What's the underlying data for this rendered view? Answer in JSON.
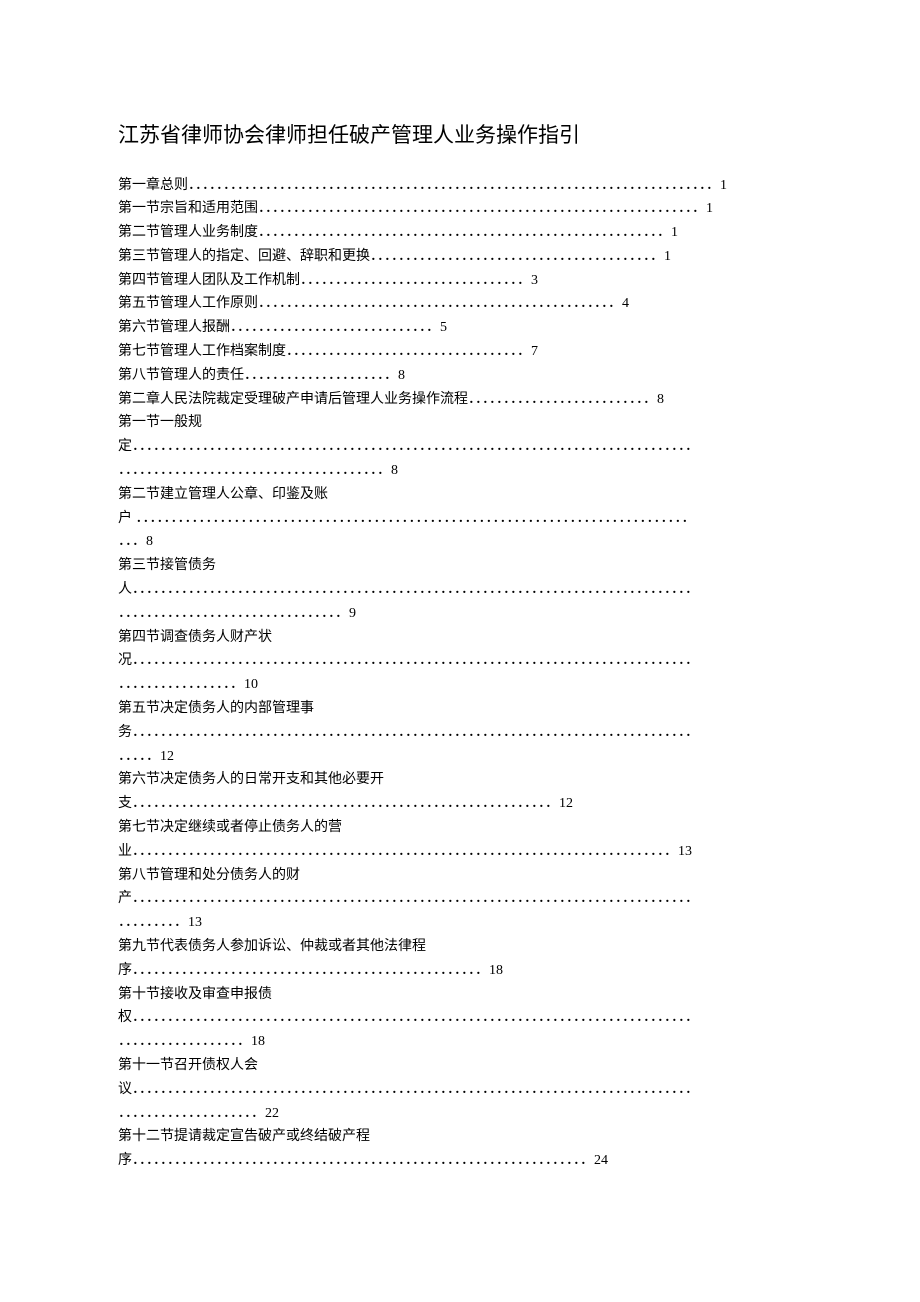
{
  "title": "江苏省律师协会律师担任破产管理人业务操作指引",
  "toc_lines": [
    "第一章总则．．．．．．．．．．．．．．．．．．．．．．．．．．．．．．．．．．．．．．．．．．．．．．．．．．．．．．．．．．．．．．．．．．．．．．．．．．．1",
    "第一节宗旨和适用范围．．．．．．．．．．．．．．．．．．．．．．．．．．．．．．．．．．．．．．．．．．．．．．．．．．．．．．．．．．．．．．．1",
    "第二节管理人业务制度．．．．．．．．．．．．．．．．．．．．．．．．．．．．．．．．．．．．．．．．．．．．．．．．．．．．．．．．．．1",
    "第三节管理人的指定、回避、辞职和更换．．．．．．．．．．．．．．．．．．．．．．．．．．．．．．．．．．．．．．．．．1",
    "第四节管理人团队及工作机制．．．．．．．．．．．．．．．．．．．．．．．．．．．．．．．．3",
    "第五节管理人工作原则．．．．．．．．．．．．．．．．．．．．．．．．．．．．．．．．．．．．．．．．．．．．．．．．．．．4",
    "第六节管理人报酬．．．．．．．．．．．．．．．．．．．．．．．．．．．．．5",
    "第七节管理人工作档案制度．．．．．．．．．．．．．．．．．．．．．．．．．．．．．．．．．．7",
    "第八节管理人的责任．．．．．．．．．．．．．．．．．．．．．8",
    "第二章人民法院裁定受理破产申请后管理人业务操作流程．．．．．．．．．．．．．．．．．．．．．．．．．．8",
    "第一节一般规",
    "定．．．．．．．．．．．．．．．．．．．．．．．．．．．．．．．．．．．．．．．．．．．．．．．．．．．．．．．．．．．．．．．．．．．．．．．．．．．．．．．．",
    "．．．．．．．．．．．．．．．．．．．．．．．．．．．．．．．．．．．．．．8",
    "第二节建立管理人公章、印鉴及账",
    "户 ．．．．．．．．．．．．．．．．．．．．．．．．．．．．．．．．．．．．．．．．．．．．．．．．．．．．．．．．．．．．．．．．．．．．．．．．．．．．．．．",
    "．．．8",
    "第三节接管债务",
    "人．．．．．．．．．．．．．．．．．．．．．．．．．．．．．．．．．．．．．．．．．．．．．．．．．．．．．．．．．．．．．．．．．．．．．．．．．．．．．．．．",
    "．．．．．．．．．．．．．．．．．．．．．．．．．．．．．．．．9",
    "第四节调查债务人财产状",
    "况．．．．．．．．．．．．．．．．．．．．．．．．．．．．．．．．．．．．．．．．．．．．．．．．．．．．．．．．．．．．．．．．．．．．．．．．．．．．．．．．",
    "．．．．．．．．．．．．．．．．．10",
    "第五节决定债务人的内部管理事",
    "务．．．．．．．．．．．．．．．．．．．．．．．．．．．．．．．．．．．．．．．．．．．．．．．．．．．．．．．．．．．．．．．．．．．．．．．．．．．．．．．．",
    "．．．．．12",
    "第六节决定债务人的日常开支和其他必要开",
    "支．．．．．．．．．．．．．．．．．．．．．．．．．．．．．．．．．．．．．．．．．．．．．．．．．．．．．．．．．．．．12",
    "第七节决定继续或者停止债务人的营",
    "业．．．．．．．．．．．．．．．．．．．．．．．．．．．．．．．．．．．．．．．．．．．．．．．．．．．．．．．．．．．．．．．．．．．．．．．．．．．．．13",
    "第八节管理和处分债务人的财",
    "产．．．．．．．．．．．．．．．．．．．．．．．．．．．．．．．．．．．．．．．．．．．．．．．．．．．．．．．．．．．．．．．．．．．．．．．．．．．．．．．．",
    "．．．．．．．．．13",
    "第九节代表债务人参加诉讼、仲裁或者其他法律程",
    "序．．．．．．．．．．．．．．．．．．．．．．．．．．．．．．．．．．．．．．．．．．．．．．．．．．18",
    "第十节接收及审查申报债",
    "权．．．．．．．．．．．．．．．．．．．．．．．．．．．．．．．．．．．．．．．．．．．．．．．．．．．．．．．．．．．．．．．．．．．．．．．．．．．．．．．．",
    "．．．．．．．．．．．．．．．．．．18",
    "第十一节召开债权人会",
    "议．．．．．．．．．．．．．．．．．．．．．．．．．．．．．．．．．．．．．．．．．．．．．．．．．．．．．．．．．．．．．．．．．．．．．．．．．．．．．．．．",
    "．．．．．．．．．．．．．．．．．．．．22",
    "第十二节提请裁定宣告破产或终结破产程",
    "序．．．．．．．．．．．．．．．．．．．．．．．．．．．．．．．．．．．．．．．．．．．．．．．．．．．．．．．．．．．．．．．．．24"
  ]
}
